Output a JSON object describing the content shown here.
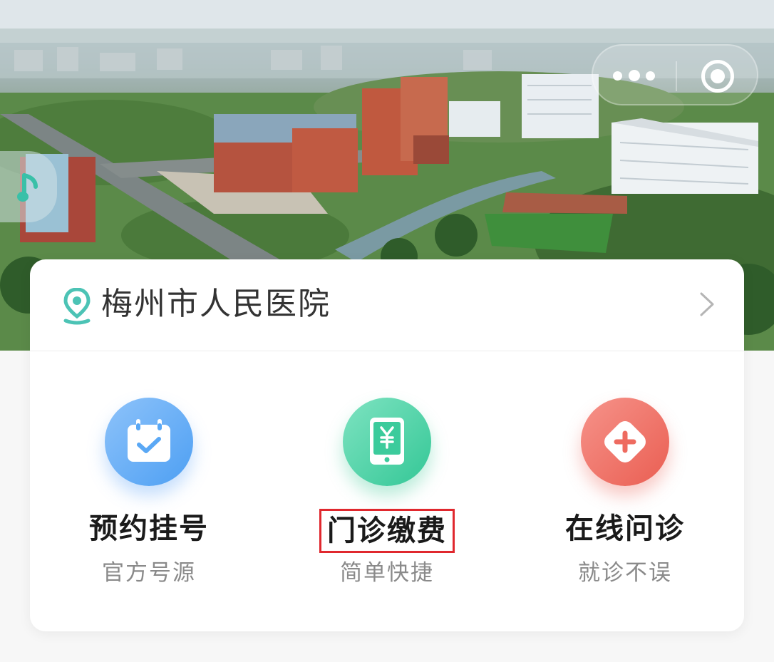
{
  "hospital": {
    "name": "梅州市人民医院"
  },
  "services": [
    {
      "title": "预约挂号",
      "subtitle": "官方号源",
      "icon": "calendar-check-icon",
      "color": "#5aa8f5",
      "highlighted": false
    },
    {
      "title": "门诊缴费",
      "subtitle": "简单快捷",
      "icon": "yuan-payment-icon",
      "color": "#3ccb9c",
      "highlighted": true
    },
    {
      "title": "在线问诊",
      "subtitle": "就诊不误",
      "icon": "medical-plus-icon",
      "color": "#ee6b60",
      "highlighted": false
    }
  ],
  "colors": {
    "location_pin": "#4cc3b5",
    "highlight_box": "#e0282e"
  }
}
